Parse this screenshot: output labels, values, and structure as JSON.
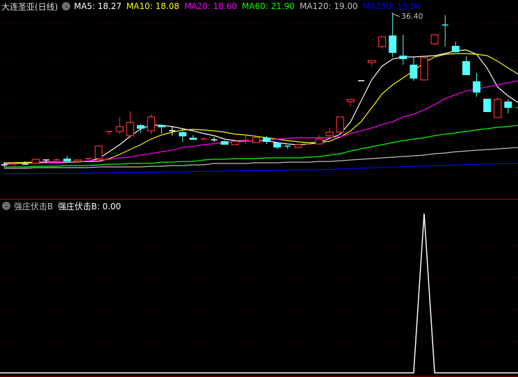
{
  "main_header": {
    "title": "大连圣亚(日线)",
    "collapse_icon": "chevron-down-circle-icon",
    "ma": [
      {
        "label": "MA5: 18.27",
        "color": "#ffffff"
      },
      {
        "label": "MA10: 18.08",
        "color": "#ffff00"
      },
      {
        "label": "MA20: 18.60",
        "color": "#ff00ff"
      },
      {
        "label": "MA60: 21.90",
        "color": "#00ff00"
      },
      {
        "label": "MA120: 19.00",
        "color": "#c0c0c0"
      },
      {
        "label": "MA250: 16.94",
        "color": "#0000ff"
      }
    ]
  },
  "high_label": "36.40",
  "indicator_header": {
    "name": "强庄伏击B",
    "value_label": "强庄伏击B: 0.00",
    "collapse_icon": "chevron-down-circle-icon"
  },
  "colors": {
    "up": "#ff3232",
    "down": "#54ffff",
    "grid": "#8b0000",
    "indicator": "#ffffff"
  },
  "chart_data": [
    {
      "type": "candlestick",
      "title": "大连圣亚(日线)",
      "ylim": [
        15.0,
        37.5
      ],
      "candles": [
        [
          16.73,
          17.09,
          16.46,
          16.7
        ],
        [
          16.8,
          16.91,
          16.46,
          16.85
        ],
        [
          16.82,
          17.18,
          16.82,
          16.82
        ],
        [
          16.91,
          17.55,
          16.82,
          17.46
        ],
        [
          17.37,
          17.37,
          17.0,
          17.33
        ],
        [
          17.33,
          17.55,
          17.33,
          17.37
        ],
        [
          17.55,
          17.91,
          17.18,
          17.18
        ],
        [
          17.18,
          17.4,
          17.18,
          17.37
        ],
        [
          17.37,
          17.55,
          17.37,
          17.55
        ],
        [
          17.55,
          19.18,
          17.46,
          19.18
        ],
        [
          20.99,
          21.08,
          20.63,
          21.08
        ],
        [
          21.08,
          22.99,
          20.72,
          21.72
        ],
        [
          20.54,
          23.71,
          20.27,
          22.26
        ],
        [
          21.9,
          22.08,
          20.9,
          21.45
        ],
        [
          21.17,
          23.35,
          20.72,
          22.99
        ],
        [
          21.9,
          21.9,
          20.81,
          21.63
        ],
        [
          21.17,
          21.72,
          20.54,
          21.2
        ],
        [
          20.99,
          21.17,
          19.72,
          20.45
        ],
        [
          20.27,
          20.63,
          20.27,
          20.0
        ],
        [
          20.09,
          20.36,
          20.09,
          20.05
        ],
        [
          20.0,
          20.36,
          19.72,
          20.0
        ],
        [
          19.81,
          19.9,
          19.36,
          19.36
        ],
        [
          19.36,
          19.81,
          19.36,
          19.81
        ],
        [
          19.9,
          20.63,
          19.45,
          19.93
        ],
        [
          19.63,
          20.27,
          19.63,
          20.27
        ],
        [
          20.27,
          20.45,
          19.45,
          19.72
        ],
        [
          19.63,
          19.63,
          18.82,
          19.0
        ],
        [
          19.18,
          19.18,
          18.82,
          19.0
        ],
        [
          19.0,
          19.4,
          19.0,
          19.36
        ],
        [
          19.45,
          19.6,
          19.4,
          19.45
        ],
        [
          19.45,
          20.63,
          19.4,
          20.09
        ],
        [
          20.54,
          21.54,
          20.27,
          20.99
        ],
        [
          20.99,
          22.99,
          20.81,
          22.99
        ],
        [
          24.98,
          25.26,
          24.35,
          25.26
        ],
        [
          27.7,
          27.7,
          27.7,
          27.7
        ],
        [
          30.06,
          30.34,
          29.61,
          30.34
        ],
        [
          32.15,
          33.42,
          31.88,
          33.42
        ],
        [
          33.6,
          36.4,
          30.79,
          31.33
        ],
        [
          30.97,
          33.69,
          29.79,
          30.52
        ],
        [
          29.79,
          30.88,
          27.7,
          27.98
        ],
        [
          27.8,
          30.7,
          27.8,
          30.7
        ],
        [
          32.51,
          33.69,
          32.33,
          33.69
        ],
        [
          34.96,
          36.23,
          32.15,
          34.9
        ],
        [
          32.24,
          32.78,
          32.24,
          31.42
        ],
        [
          30.24,
          30.88,
          28.43,
          28.43
        ],
        [
          27.62,
          28.7,
          25.62,
          26.16
        ],
        [
          25.35,
          25.35,
          23.62,
          23.62
        ],
        [
          22.9,
          25.53,
          22.9,
          25.26
        ],
        [
          24.98,
          25.26,
          23.44,
          24.17
        ],
        [
          24.17,
          25.26,
          23.9,
          24.2
        ]
      ],
      "series": [
        {
          "name": "MA5",
          "color": "#ffffff",
          "values": [
            16.85,
            16.9,
            16.95,
            17.0,
            17.0,
            17.0,
            17.05,
            17.1,
            17.2,
            17.55,
            18.45,
            19.36,
            20.45,
            21.45,
            21.9,
            21.9,
            21.72,
            21.45,
            21.17,
            20.81,
            20.54,
            20.09,
            19.9,
            19.81,
            19.9,
            19.9,
            19.63,
            19.45,
            19.36,
            19.45,
            19.63,
            20.18,
            20.72,
            22.35,
            25.08,
            27.8,
            29.61,
            30.52,
            30.79,
            30.79,
            30.88,
            30.97,
            31.24,
            31.6,
            31.7,
            31.15,
            29.34,
            26.89,
            25.71,
            24.8
          ]
        },
        {
          "name": "MA10",
          "color": "#ffff00",
          "values": [
            17.0,
            17.02,
            17.05,
            17.08,
            17.1,
            17.1,
            17.12,
            17.14,
            17.16,
            17.18,
            17.55,
            18.09,
            18.73,
            19.36,
            20.09,
            20.63,
            20.99,
            21.27,
            21.36,
            21.27,
            21.17,
            20.99,
            20.72,
            20.63,
            20.45,
            20.27,
            20.09,
            19.9,
            19.72,
            19.63,
            19.63,
            19.81,
            20.36,
            21.17,
            22.35,
            24.17,
            25.99,
            27.17,
            28.07,
            28.98,
            30.06,
            30.79,
            31.15,
            31.24,
            31.24,
            31.15,
            30.97,
            30.24,
            29.34,
            28.52
          ]
        },
        {
          "name": "MA20",
          "color": "#ff00ff",
          "values": [
            16.8,
            16.85,
            16.9,
            16.95,
            17.0,
            17.05,
            17.1,
            17.15,
            17.25,
            17.37,
            17.46,
            17.64,
            17.75,
            18.0,
            18.2,
            18.45,
            18.65,
            19.0,
            19.15,
            19.36,
            19.5,
            19.63,
            19.72,
            19.8,
            19.9,
            20.0,
            20.09,
            20.18,
            20.27,
            20.27,
            20.27,
            20.27,
            20.4,
            20.81,
            21.17,
            21.54,
            22.0,
            22.35,
            23.0,
            23.35,
            23.9,
            24.6,
            25.35,
            25.9,
            26.35,
            26.6,
            26.9,
            27.16,
            27.43,
            27.7
          ]
        },
        {
          "name": "MA60",
          "color": "#00ff00",
          "values": [
            16.46,
            16.46,
            16.46,
            16.55,
            16.55,
            16.55,
            16.64,
            16.64,
            16.64,
            16.73,
            16.82,
            16.82,
            16.91,
            16.91,
            16.91,
            17.09,
            17.09,
            17.18,
            17.18,
            17.37,
            17.46,
            17.46,
            17.55,
            17.55,
            17.55,
            17.64,
            17.64,
            17.64,
            17.64,
            17.73,
            17.82,
            18.0,
            18.18,
            18.54,
            18.82,
            19.09,
            19.36,
            19.63,
            19.9,
            20.09,
            20.27,
            20.54,
            20.72,
            20.9,
            21.08,
            21.27,
            21.45,
            21.63,
            21.72,
            21.9
          ]
        },
        {
          "name": "MA120",
          "color": "#c0c0c0",
          "values": [
            16.28,
            16.28,
            16.28,
            16.37,
            16.37,
            16.37,
            16.37,
            16.37,
            16.37,
            16.46,
            16.46,
            16.46,
            16.46,
            16.46,
            16.55,
            16.55,
            16.64,
            16.64,
            16.73,
            16.73,
            16.91,
            16.91,
            16.91,
            16.91,
            17.0,
            17.0,
            17.0,
            17.09,
            17.09,
            17.09,
            17.18,
            17.18,
            17.27,
            17.37,
            17.46,
            17.55,
            17.64,
            17.73,
            17.82,
            17.91,
            18.0,
            18.18,
            18.27,
            18.45,
            18.54,
            18.64,
            18.73,
            18.82,
            18.91,
            19.0
          ]
        },
        {
          "name": "MA250",
          "color": "#0000ff",
          "values": [
            15.55,
            15.6,
            15.6,
            15.6,
            15.6,
            15.62,
            15.62,
            15.64,
            15.64,
            15.66,
            15.7,
            15.7,
            15.73,
            15.73,
            15.75,
            15.8,
            15.82,
            15.82,
            15.85,
            15.9,
            15.9,
            15.92,
            15.95,
            15.97,
            16.0,
            16.0,
            16.02,
            16.05,
            16.08,
            16.1,
            16.1,
            16.15,
            16.2,
            16.25,
            16.3,
            16.35,
            16.4,
            16.45,
            16.5,
            16.55,
            16.6,
            16.62,
            16.65,
            16.7,
            16.75,
            16.8,
            16.82,
            16.85,
            16.9,
            16.94
          ]
        }
      ]
    },
    {
      "type": "line",
      "title": "强庄伏击B",
      "ylim": [
        0,
        100
      ],
      "series": [
        {
          "name": "强庄伏击B",
          "color": "#ffffff",
          "values": [
            0,
            0,
            0,
            0,
            0,
            0,
            0,
            0,
            0,
            0,
            0,
            0,
            0,
            0,
            0,
            0,
            0,
            0,
            0,
            0,
            0,
            0,
            0,
            0,
            0,
            0,
            0,
            0,
            0,
            0,
            0,
            0,
            0,
            0,
            0,
            0,
            0,
            0,
            0,
            0,
            100,
            0,
            0,
            0,
            0,
            0,
            0,
            0,
            0,
            0
          ]
        }
      ]
    }
  ]
}
